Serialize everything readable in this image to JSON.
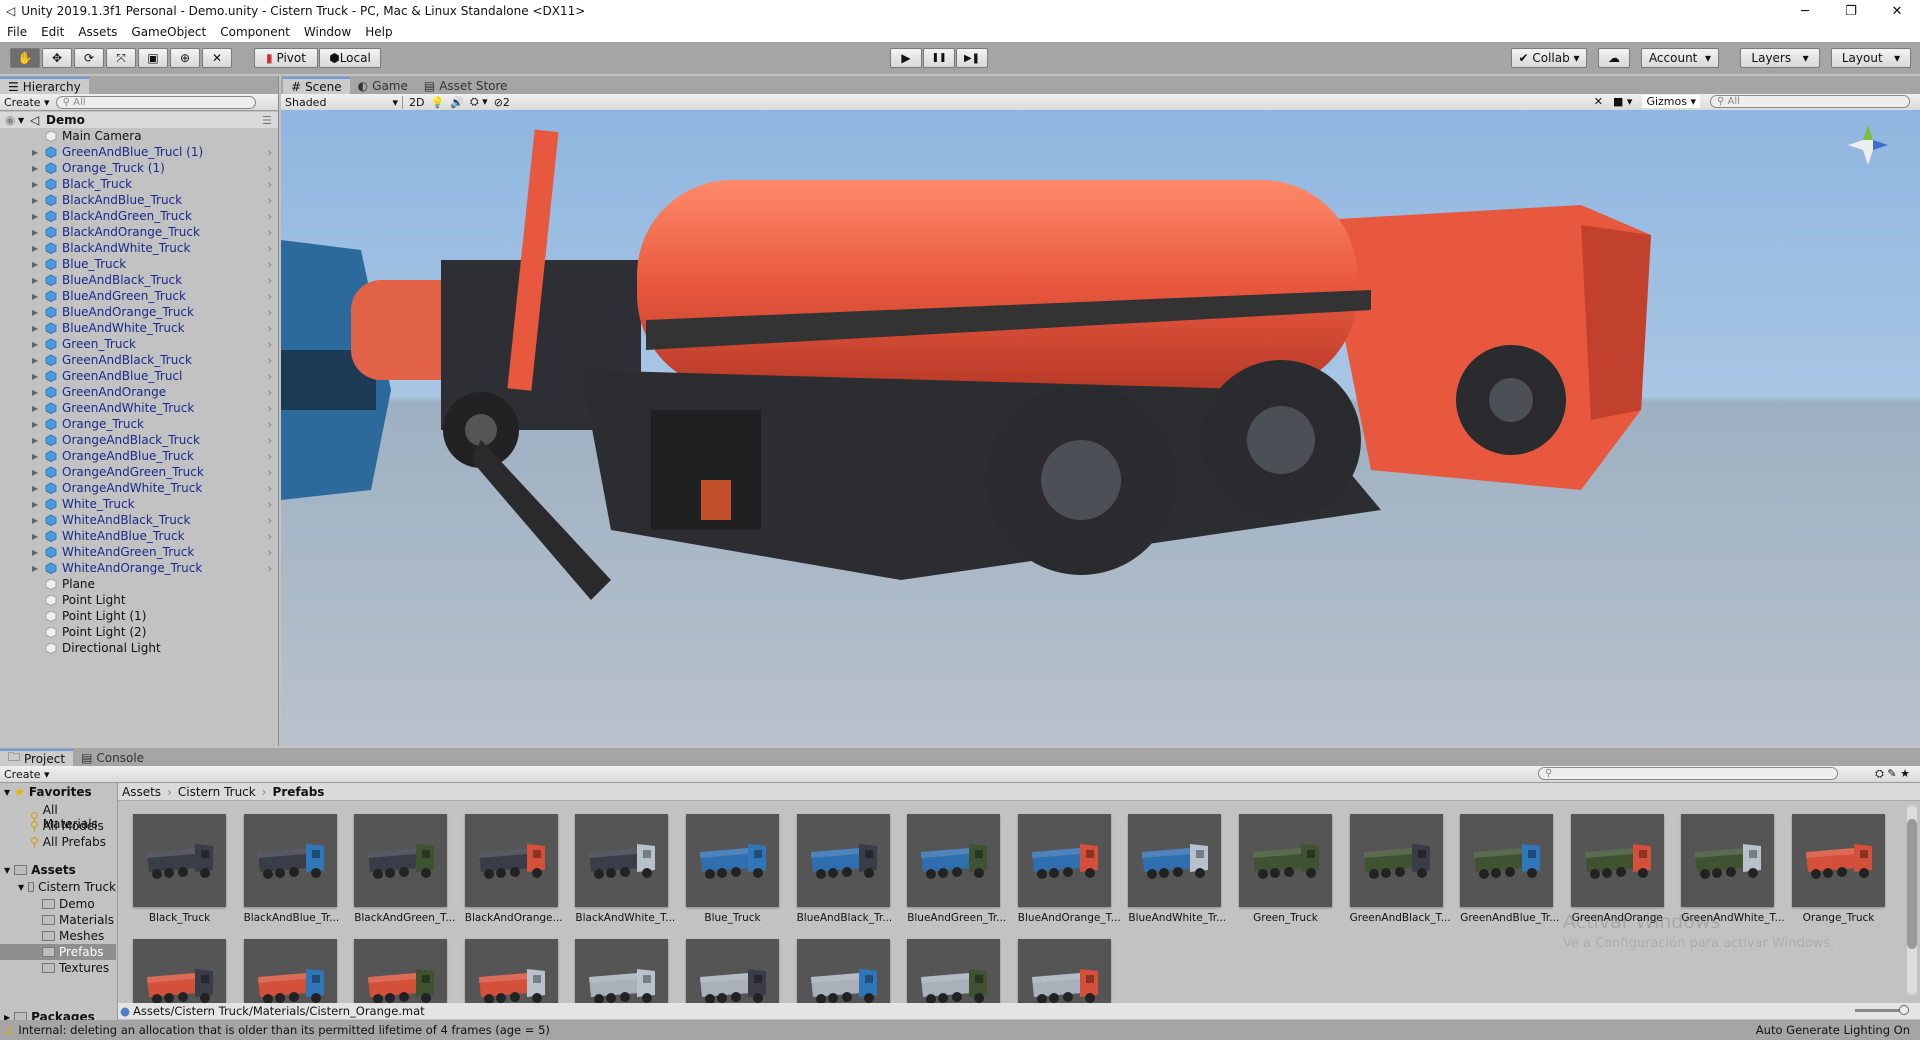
{
  "window": {
    "title": "Unity 2019.1.3f1 Personal - Demo.unity - Cistern Truck - PC, Mac & Linux Standalone <DX11>",
    "minimize": "─",
    "restore": "❐",
    "close": "✕"
  },
  "menu": [
    "File",
    "Edit",
    "Assets",
    "GameObject",
    "Component",
    "Window",
    "Help"
  ],
  "toolbar": {
    "pivot": "Pivot",
    "local": "Local",
    "collab": "Collab",
    "account": "Account",
    "layers": "Layers",
    "layout": "Layout",
    "play": "▶",
    "pause": "❚❚",
    "step": "▶❚"
  },
  "hierarchy": {
    "tab": "Hierarchy",
    "create": "Create",
    "search_placeholder": "All",
    "scene": "Demo",
    "items": [
      {
        "label": "Main Camera",
        "prefab": false
      },
      {
        "label": "GreenAndBlue_Trucl (1)",
        "prefab": true
      },
      {
        "label": "Orange_Truck (1)",
        "prefab": true
      },
      {
        "label": "Black_Truck",
        "prefab": true
      },
      {
        "label": "BlackAndBlue_Truck",
        "prefab": true
      },
      {
        "label": "BlackAndGreen_Truck",
        "prefab": true
      },
      {
        "label": "BlackAndOrange_Truck",
        "prefab": true
      },
      {
        "label": "BlackAndWhite_Truck",
        "prefab": true
      },
      {
        "label": "Blue_Truck",
        "prefab": true
      },
      {
        "label": "BlueAndBlack_Truck",
        "prefab": true
      },
      {
        "label": "BlueAndGreen_Truck",
        "prefab": true
      },
      {
        "label": "BlueAndOrange_Truck",
        "prefab": true
      },
      {
        "label": "BlueAndWhite_Truck",
        "prefab": true
      },
      {
        "label": "Green_Truck",
        "prefab": true
      },
      {
        "label": "GreenAndBlack_Truck",
        "prefab": true
      },
      {
        "label": "GreenAndBlue_Trucl",
        "prefab": true
      },
      {
        "label": "GreenAndOrange",
        "prefab": true
      },
      {
        "label": "GreenAndWhite_Truck",
        "prefab": true
      },
      {
        "label": "Orange_Truck",
        "prefab": true
      },
      {
        "label": "OrangeAndBlack_Truck",
        "prefab": true
      },
      {
        "label": "OrangeAndBlue_Truck",
        "prefab": true
      },
      {
        "label": "OrangeAndGreen_Truck",
        "prefab": true
      },
      {
        "label": "OrangeAndWhite_Truck",
        "prefab": true
      },
      {
        "label": "White_Truck",
        "prefab": true
      },
      {
        "label": "WhiteAndBlack_Truck",
        "prefab": true
      },
      {
        "label": "WhiteAndBlue_Truck",
        "prefab": true
      },
      {
        "label": "WhiteAndGreen_Truck",
        "prefab": true
      },
      {
        "label": "WhiteAndOrange_Truck",
        "prefab": true
      },
      {
        "label": "Plane",
        "prefab": false
      },
      {
        "label": "Point Light",
        "prefab": false
      },
      {
        "label": "Point Light (1)",
        "prefab": false
      },
      {
        "label": "Point Light (2)",
        "prefab": false
      },
      {
        "label": "Directional Light",
        "prefab": false
      }
    ]
  },
  "scene": {
    "tabs": [
      "Scene",
      "Game",
      "Asset Store"
    ],
    "shading": "Shaded",
    "mode_2d": "2D",
    "hidden_count": "2",
    "gizmos": "Gizmos",
    "search_placeholder": "All"
  },
  "project": {
    "tabs": [
      "Project",
      "Console"
    ],
    "create": "Create",
    "favorites": {
      "label": "Favorites",
      "items": [
        "All Materials",
        "All Models",
        "All Prefabs"
      ]
    },
    "assets": {
      "label": "Assets",
      "child": "Cistern Truck",
      "folders": [
        "Demo",
        "Materials",
        "Meshes",
        "Prefabs",
        "Textures"
      ],
      "selected": "Prefabs"
    },
    "packages": "Packages",
    "breadcrumb": [
      "Assets",
      "Cistern Truck",
      "Prefabs"
    ],
    "grid": [
      {
        "label": "Black_Truck",
        "tank": "#3a3d48",
        "cab": "#3a3d48"
      },
      {
        "label": "BlackAndBlue_Tr...",
        "tank": "#3a3d48",
        "cab": "#2f77b8"
      },
      {
        "label": "BlackAndGreen_T...",
        "tank": "#3a3d48",
        "cab": "#3f5231"
      },
      {
        "label": "BlackAndOrange...",
        "tank": "#3a3d48",
        "cab": "#d5503a"
      },
      {
        "label": "BlackAndWhite_T...",
        "tank": "#3a3d48",
        "cab": "#b9c1cc"
      },
      {
        "label": "Blue_Truck",
        "tank": "#2f6fb0",
        "cab": "#2f77b8"
      },
      {
        "label": "BlueAndBlack_Tr...",
        "tank": "#2f6fb0",
        "cab": "#3a3d48"
      },
      {
        "label": "BlueAndGreen_Tr...",
        "tank": "#2f6fb0",
        "cab": "#3f5231"
      },
      {
        "label": "BlueAndOrange_T...",
        "tank": "#2f6fb0",
        "cab": "#d5503a"
      },
      {
        "label": "BlueAndWhite_Tr...",
        "tank": "#2f6fb0",
        "cab": "#b9c1cc"
      },
      {
        "label": "Green_Truck",
        "tank": "#3f5231",
        "cab": "#3f5231"
      },
      {
        "label": "GreenAndBlack_T...",
        "tank": "#3f5231",
        "cab": "#3a3d48"
      },
      {
        "label": "GreenAndBlue_Tr...",
        "tank": "#3f5231",
        "cab": "#2f77b8"
      },
      {
        "label": "GreenAndOrange",
        "tank": "#3f5231",
        "cab": "#d5503a"
      },
      {
        "label": "GreenAndWhite_T...",
        "tank": "#3f5231",
        "cab": "#b9c1cc"
      },
      {
        "label": "Orange_Truck",
        "tank": "#d5503a",
        "cab": "#d5503a"
      },
      {
        "tank": "#d5503a",
        "cab": "#3a3d48"
      },
      {
        "tank": "#d5503a",
        "cab": "#2f77b8"
      },
      {
        "tank": "#d5503a",
        "cab": "#3f5231"
      },
      {
        "tank": "#d5503a",
        "cab": "#b9c1cc"
      },
      {
        "tank": "#a9b0ba",
        "cab": "#b9c1cc"
      },
      {
        "tank": "#a9b0ba",
        "cab": "#3a3d48"
      },
      {
        "tank": "#a9b0ba",
        "cab": "#2f77b8"
      },
      {
        "tank": "#a9b0ba",
        "cab": "#3f5231"
      },
      {
        "tank": "#a9b0ba",
        "cab": "#d5503a"
      }
    ],
    "selected_path": "Assets/Cistern Truck/Materials/Cistern_Orange.mat",
    "watermark_title": "Activar Windows",
    "watermark_sub": "Ve a Configuración para activar Windows."
  },
  "status": {
    "message": "Internal: deleting an allocation that is older than its permitted lifetime of 4 frames (age = 5)",
    "lighting": "Auto Generate Lighting On"
  },
  "colors": {
    "accent": "#6f9ddc",
    "prefab_text": "#1a2a8c",
    "truck_orange": "#e8583e",
    "sky": "#8fb6e0"
  }
}
